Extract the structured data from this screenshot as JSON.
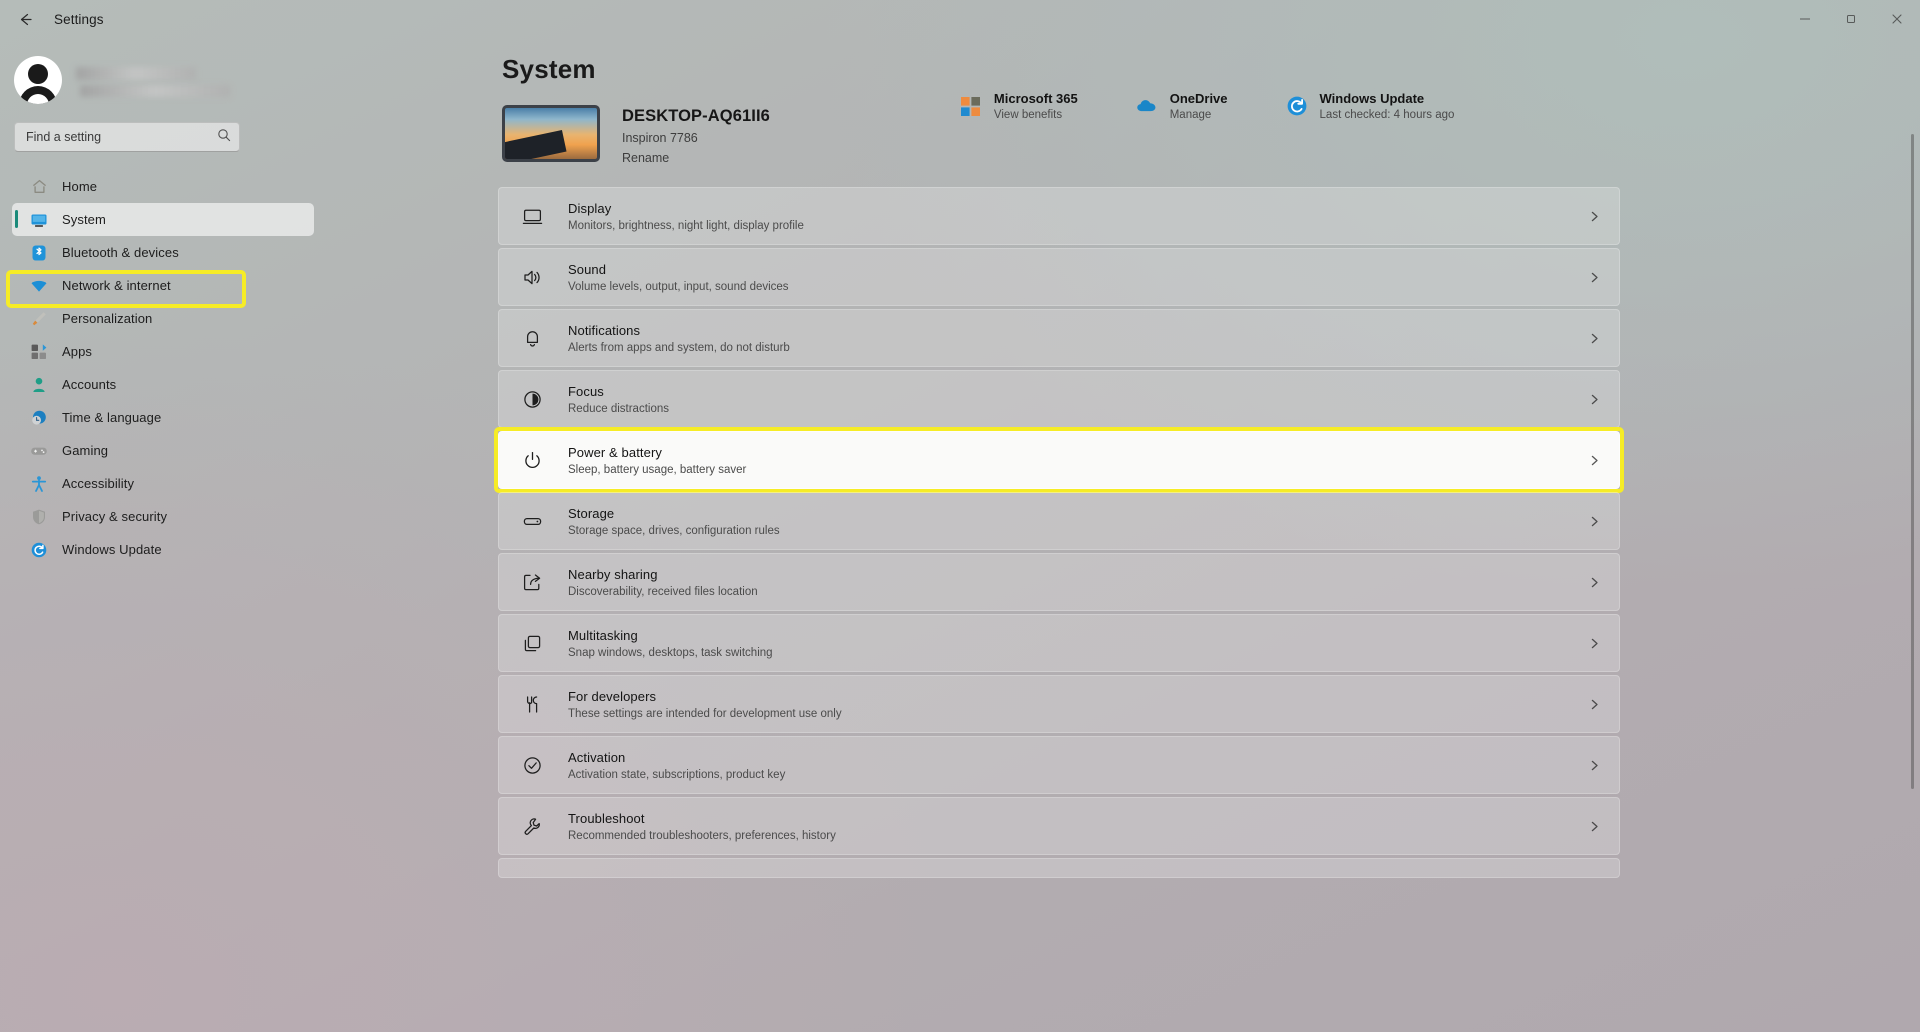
{
  "window": {
    "title": "Settings",
    "back_icon": "back-arrow-icon",
    "controls": [
      {
        "name": "minimize",
        "glyph": "minimize-icon"
      },
      {
        "name": "maximize",
        "glyph": "maximize-icon"
      },
      {
        "name": "close",
        "glyph": "close-icon"
      }
    ]
  },
  "sidebar": {
    "account": {
      "avatar_icon": "default-user-avatar-icon",
      "name_redacted": "",
      "email_redacted": ""
    },
    "search": {
      "placeholder": "Find a setting",
      "icon": "search-icon"
    },
    "items": [
      {
        "label": "Home",
        "icon": "home-icon",
        "selected": false
      },
      {
        "label": "System",
        "icon": "system-monitor-icon",
        "selected": true
      },
      {
        "label": "Bluetooth & devices",
        "icon": "bluetooth-icon",
        "selected": false
      },
      {
        "label": "Network & internet",
        "icon": "wifi-icon",
        "selected": false
      },
      {
        "label": "Personalization",
        "icon": "paintbrush-icon",
        "selected": false
      },
      {
        "label": "Apps",
        "icon": "apps-grid-icon",
        "selected": false
      },
      {
        "label": "Accounts",
        "icon": "person-icon",
        "selected": false
      },
      {
        "label": "Time & language",
        "icon": "clock-globe-icon",
        "selected": false
      },
      {
        "label": "Gaming",
        "icon": "gamepad-icon",
        "selected": false
      },
      {
        "label": "Accessibility",
        "icon": "accessibility-person-icon",
        "selected": false
      },
      {
        "label": "Privacy & security",
        "icon": "shield-icon",
        "selected": false
      },
      {
        "label": "Windows Update",
        "icon": "update-refresh-icon",
        "selected": false
      }
    ]
  },
  "main": {
    "page_title": "System",
    "device": {
      "thumbnail_icon": "laptop-thumbnail-icon",
      "name": "DESKTOP-AQ61II6",
      "model": "Inspiron 7786",
      "rename_label": "Rename"
    },
    "quick_links": [
      {
        "title": "Microsoft 365",
        "subtitle": "View benefits",
        "icon": "microsoft-logo-icon"
      },
      {
        "title": "OneDrive",
        "subtitle": "Manage",
        "icon": "onedrive-cloud-icon"
      },
      {
        "title": "Windows Update",
        "subtitle": "Last checked: 4 hours ago",
        "icon": "update-refresh-icon"
      }
    ],
    "rows": [
      {
        "title": "Display",
        "subtitle": "Monitors, brightness, night light, display profile",
        "icon": "display-monitor-icon",
        "highlighted": false
      },
      {
        "title": "Sound",
        "subtitle": "Volume levels, output, input, sound devices",
        "icon": "speaker-icon",
        "highlighted": false
      },
      {
        "title": "Notifications",
        "subtitle": "Alerts from apps and system, do not disturb",
        "icon": "bell-icon",
        "highlighted": false
      },
      {
        "title": "Focus",
        "subtitle": "Reduce distractions",
        "icon": "focus-moon-icon",
        "highlighted": false
      },
      {
        "title": "Power & battery",
        "subtitle": "Sleep, battery usage, battery saver",
        "icon": "power-icon",
        "highlighted": true
      },
      {
        "title": "Storage",
        "subtitle": "Storage space, drives, configuration rules",
        "icon": "storage-drive-icon",
        "highlighted": false
      },
      {
        "title": "Nearby sharing",
        "subtitle": "Discoverability, received files location",
        "icon": "nearby-share-icon",
        "highlighted": false
      },
      {
        "title": "Multitasking",
        "subtitle": "Snap windows, desktops, task switching",
        "icon": "multitasking-windows-icon",
        "highlighted": false
      },
      {
        "title": "For developers",
        "subtitle": "These settings are intended for development use only",
        "icon": "developer-tools-icon",
        "highlighted": false
      },
      {
        "title": "Activation",
        "subtitle": "Activation state, subscriptions, product key",
        "icon": "checkmark-circle-icon",
        "highlighted": false
      },
      {
        "title": "Troubleshoot",
        "subtitle": "Recommended troubleshooters, preferences, history",
        "icon": "wrench-icon",
        "highlighted": false
      }
    ],
    "chevron_icon": "chevron-right-icon"
  },
  "colors": {
    "highlight": "#f6ec26",
    "accent_bar": "#1b8a7a",
    "ms365_orange": "#f0812a",
    "onedrive_blue": "#0f7fc4",
    "update_blue": "#0f86d8"
  }
}
